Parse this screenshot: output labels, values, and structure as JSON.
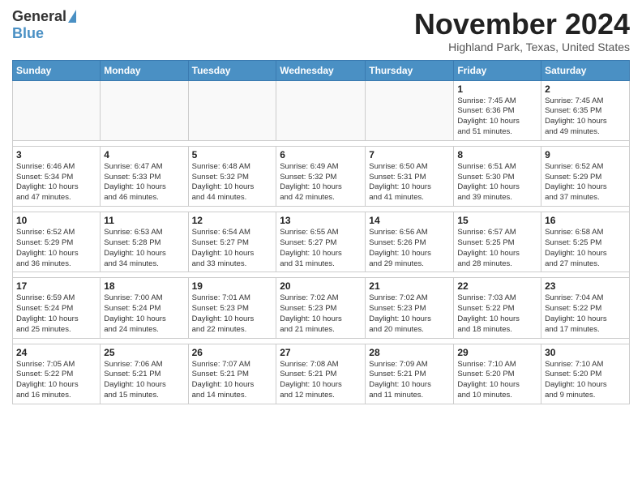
{
  "logo": {
    "general": "General",
    "blue": "Blue"
  },
  "header": {
    "month": "November 2024",
    "location": "Highland Park, Texas, United States"
  },
  "weekdays": [
    "Sunday",
    "Monday",
    "Tuesday",
    "Wednesday",
    "Thursday",
    "Friday",
    "Saturday"
  ],
  "weeks": [
    [
      {
        "day": "",
        "info": ""
      },
      {
        "day": "",
        "info": ""
      },
      {
        "day": "",
        "info": ""
      },
      {
        "day": "",
        "info": ""
      },
      {
        "day": "",
        "info": ""
      },
      {
        "day": "1",
        "info": "Sunrise: 7:45 AM\nSunset: 6:36 PM\nDaylight: 10 hours\nand 51 minutes."
      },
      {
        "day": "2",
        "info": "Sunrise: 7:45 AM\nSunset: 6:35 PM\nDaylight: 10 hours\nand 49 minutes."
      }
    ],
    [
      {
        "day": "3",
        "info": "Sunrise: 6:46 AM\nSunset: 5:34 PM\nDaylight: 10 hours\nand 47 minutes."
      },
      {
        "day": "4",
        "info": "Sunrise: 6:47 AM\nSunset: 5:33 PM\nDaylight: 10 hours\nand 46 minutes."
      },
      {
        "day": "5",
        "info": "Sunrise: 6:48 AM\nSunset: 5:32 PM\nDaylight: 10 hours\nand 44 minutes."
      },
      {
        "day": "6",
        "info": "Sunrise: 6:49 AM\nSunset: 5:32 PM\nDaylight: 10 hours\nand 42 minutes."
      },
      {
        "day": "7",
        "info": "Sunrise: 6:50 AM\nSunset: 5:31 PM\nDaylight: 10 hours\nand 41 minutes."
      },
      {
        "day": "8",
        "info": "Sunrise: 6:51 AM\nSunset: 5:30 PM\nDaylight: 10 hours\nand 39 minutes."
      },
      {
        "day": "9",
        "info": "Sunrise: 6:52 AM\nSunset: 5:29 PM\nDaylight: 10 hours\nand 37 minutes."
      }
    ],
    [
      {
        "day": "10",
        "info": "Sunrise: 6:52 AM\nSunset: 5:29 PM\nDaylight: 10 hours\nand 36 minutes."
      },
      {
        "day": "11",
        "info": "Sunrise: 6:53 AM\nSunset: 5:28 PM\nDaylight: 10 hours\nand 34 minutes."
      },
      {
        "day": "12",
        "info": "Sunrise: 6:54 AM\nSunset: 5:27 PM\nDaylight: 10 hours\nand 33 minutes."
      },
      {
        "day": "13",
        "info": "Sunrise: 6:55 AM\nSunset: 5:27 PM\nDaylight: 10 hours\nand 31 minutes."
      },
      {
        "day": "14",
        "info": "Sunrise: 6:56 AM\nSunset: 5:26 PM\nDaylight: 10 hours\nand 29 minutes."
      },
      {
        "day": "15",
        "info": "Sunrise: 6:57 AM\nSunset: 5:25 PM\nDaylight: 10 hours\nand 28 minutes."
      },
      {
        "day": "16",
        "info": "Sunrise: 6:58 AM\nSunset: 5:25 PM\nDaylight: 10 hours\nand 27 minutes."
      }
    ],
    [
      {
        "day": "17",
        "info": "Sunrise: 6:59 AM\nSunset: 5:24 PM\nDaylight: 10 hours\nand 25 minutes."
      },
      {
        "day": "18",
        "info": "Sunrise: 7:00 AM\nSunset: 5:24 PM\nDaylight: 10 hours\nand 24 minutes."
      },
      {
        "day": "19",
        "info": "Sunrise: 7:01 AM\nSunset: 5:23 PM\nDaylight: 10 hours\nand 22 minutes."
      },
      {
        "day": "20",
        "info": "Sunrise: 7:02 AM\nSunset: 5:23 PM\nDaylight: 10 hours\nand 21 minutes."
      },
      {
        "day": "21",
        "info": "Sunrise: 7:02 AM\nSunset: 5:23 PM\nDaylight: 10 hours\nand 20 minutes."
      },
      {
        "day": "22",
        "info": "Sunrise: 7:03 AM\nSunset: 5:22 PM\nDaylight: 10 hours\nand 18 minutes."
      },
      {
        "day": "23",
        "info": "Sunrise: 7:04 AM\nSunset: 5:22 PM\nDaylight: 10 hours\nand 17 minutes."
      }
    ],
    [
      {
        "day": "24",
        "info": "Sunrise: 7:05 AM\nSunset: 5:22 PM\nDaylight: 10 hours\nand 16 minutes."
      },
      {
        "day": "25",
        "info": "Sunrise: 7:06 AM\nSunset: 5:21 PM\nDaylight: 10 hours\nand 15 minutes."
      },
      {
        "day": "26",
        "info": "Sunrise: 7:07 AM\nSunset: 5:21 PM\nDaylight: 10 hours\nand 14 minutes."
      },
      {
        "day": "27",
        "info": "Sunrise: 7:08 AM\nSunset: 5:21 PM\nDaylight: 10 hours\nand 12 minutes."
      },
      {
        "day": "28",
        "info": "Sunrise: 7:09 AM\nSunset: 5:21 PM\nDaylight: 10 hours\nand 11 minutes."
      },
      {
        "day": "29",
        "info": "Sunrise: 7:10 AM\nSunset: 5:20 PM\nDaylight: 10 hours\nand 10 minutes."
      },
      {
        "day": "30",
        "info": "Sunrise: 7:10 AM\nSunset: 5:20 PM\nDaylight: 10 hours\nand 9 minutes."
      }
    ]
  ]
}
